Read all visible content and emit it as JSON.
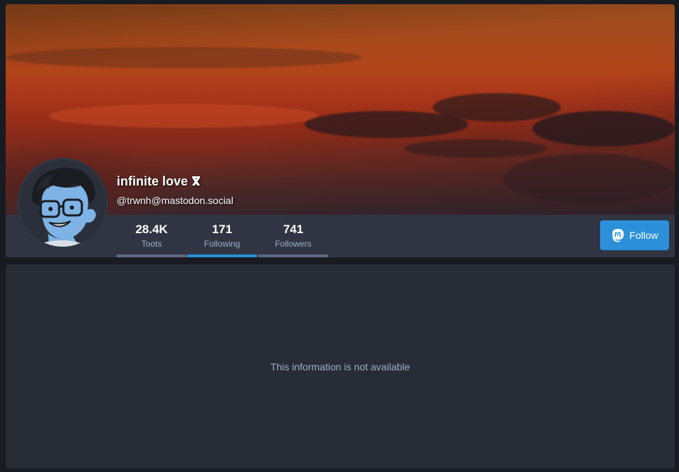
{
  "profile": {
    "display_name": "infinite love ⴳ",
    "handle": "@trwnh@mastodon.social",
    "stats": [
      {
        "value": "28.4K",
        "label": "Toots",
        "active": false
      },
      {
        "value": "171",
        "label": "Following",
        "active": true
      },
      {
        "value": "741",
        "label": "Followers",
        "active": false
      }
    ]
  },
  "follow_button": {
    "label": "Follow",
    "icon": "mastodon-icon"
  },
  "main": {
    "empty_message": "This information is not available"
  },
  "colors": {
    "accent": "#2b90d9",
    "page_bg": "#191b22",
    "card_bg": "#313543",
    "panel_bg": "#282c37",
    "muted_text": "#9baec8"
  }
}
